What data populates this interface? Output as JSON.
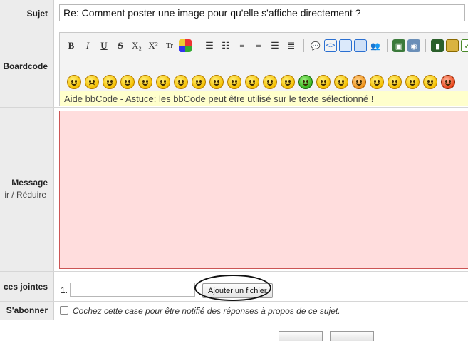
{
  "subject": {
    "label": "Sujet",
    "value": "Re: Comment poster une image pour qu'elle s'affiche directement ?"
  },
  "boardcode": {
    "label": "Boardcode",
    "format_buttons": [
      "B",
      "I",
      "U",
      "S",
      "X₂",
      "X²",
      "Tr"
    ],
    "help_text": "Aide bbCode - Astuce: les bbCode peut être utilisé sur le texte sélectionné !"
  },
  "message": {
    "label": "Message",
    "sub_links_text": "ir /  Réduire"
  },
  "attachments": {
    "label": "ces jointes",
    "number": "1.",
    "add_button_label": "Ajouter un fichier"
  },
  "subscribe": {
    "label": "S'abonner",
    "checkbox_text": "Cochez cette case pour être notifié des réponses à propos de ce sujet."
  },
  "colors": {
    "label_bg": "#ececec",
    "message_bg": "#ffdddd",
    "message_border": "#cc5555",
    "help_bg": "#ffffcc"
  }
}
